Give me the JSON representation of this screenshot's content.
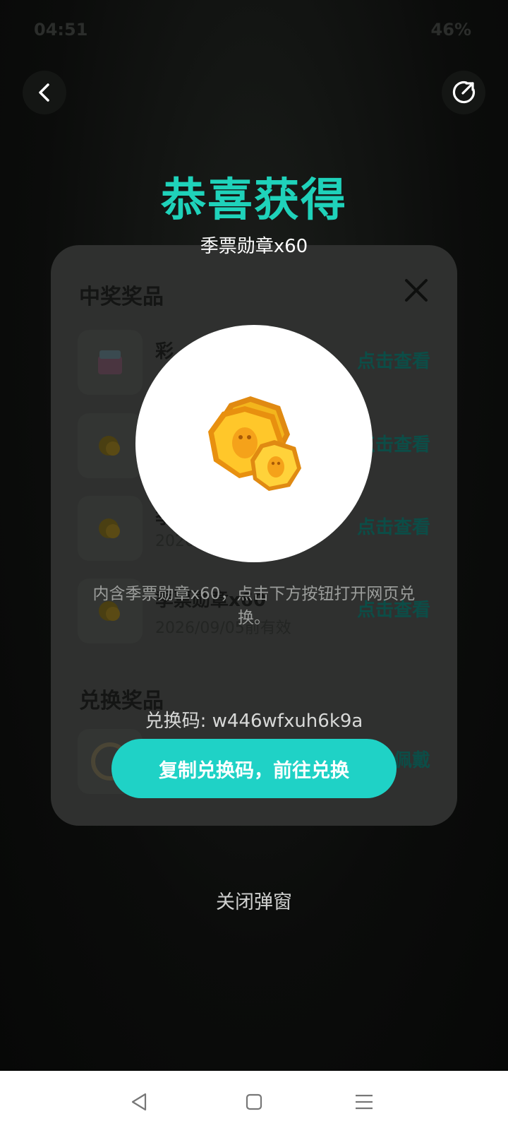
{
  "status_bar": {
    "time": "04:51",
    "battery": "46%"
  },
  "page": {
    "title": ""
  },
  "popup": {
    "congrats_title": "恭喜获得",
    "reward_name": "季票勋章x60",
    "reward_description": "内含季票勋章x60，点击下方按钮打开网页兑换。",
    "redeem_code": "兑换码: w446wfxuh6k9a",
    "primary_button": "复制兑换码，前往兑换",
    "close_label": "关闭弹窗",
    "accent_color": "#1fd2ba"
  },
  "card": {
    "title": "中奖奖品",
    "section2_title": "兑换奖品",
    "items": [
      {
        "name": "彩",
        "date": "",
        "link": "点击查看",
        "icon": "gift-box-icon"
      },
      {
        "name": "",
        "date": "",
        "link": "点击查看",
        "icon": "medal-icon"
      },
      {
        "name": "季",
        "date": "2026/",
        "link": "点击查看",
        "icon": "medal-icon"
      },
      {
        "name": "季票勋章x60",
        "date": "2026/09/05前有效",
        "link": "点击查看",
        "icon": "medal-icon"
      }
    ],
    "exchange_item_link": "佩戴"
  },
  "nav": {
    "back": "back-triangle-icon",
    "home": "home-square-icon",
    "menu": "menu-lines-icon"
  }
}
